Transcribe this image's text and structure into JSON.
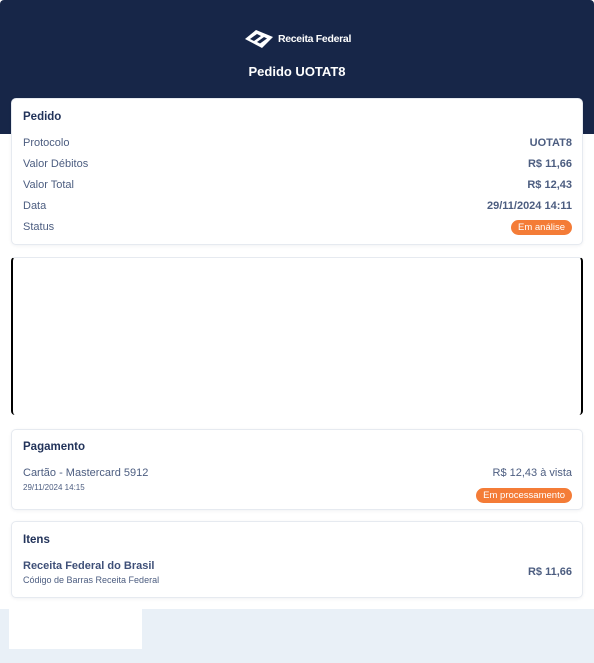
{
  "header": {
    "logo_text": "Receita Federal",
    "title": "Pedido UOTAT8",
    "bg_color": "#172648"
  },
  "pedido": {
    "title": "Pedido",
    "rows": [
      {
        "label": "Protocolo",
        "value": "UOTAT8"
      },
      {
        "label": "Valor Débitos",
        "value": "R$ 11,66"
      },
      {
        "label": "Valor Total",
        "value": "R$ 12,43"
      },
      {
        "label": "Data",
        "value": "29/11/2024 14:11"
      }
    ],
    "status_label": "Status",
    "status_value": "Em análise"
  },
  "pagamento": {
    "title": "Pagamento",
    "method": "Cartão - Mastercard 5912",
    "date": "29/11/2024 14:15",
    "amount": "R$ 12,43 à vista",
    "status": "Em processamento"
  },
  "itens": {
    "title": "Itens",
    "items": [
      {
        "name": "Receita Federal do Brasil",
        "description": "Código de Barras Receita Federal",
        "price": "R$ 11,66"
      }
    ]
  },
  "colors": {
    "accent": "#f47c37",
    "text": "#4c5d80",
    "footer_bg": "#e9f0f7"
  }
}
